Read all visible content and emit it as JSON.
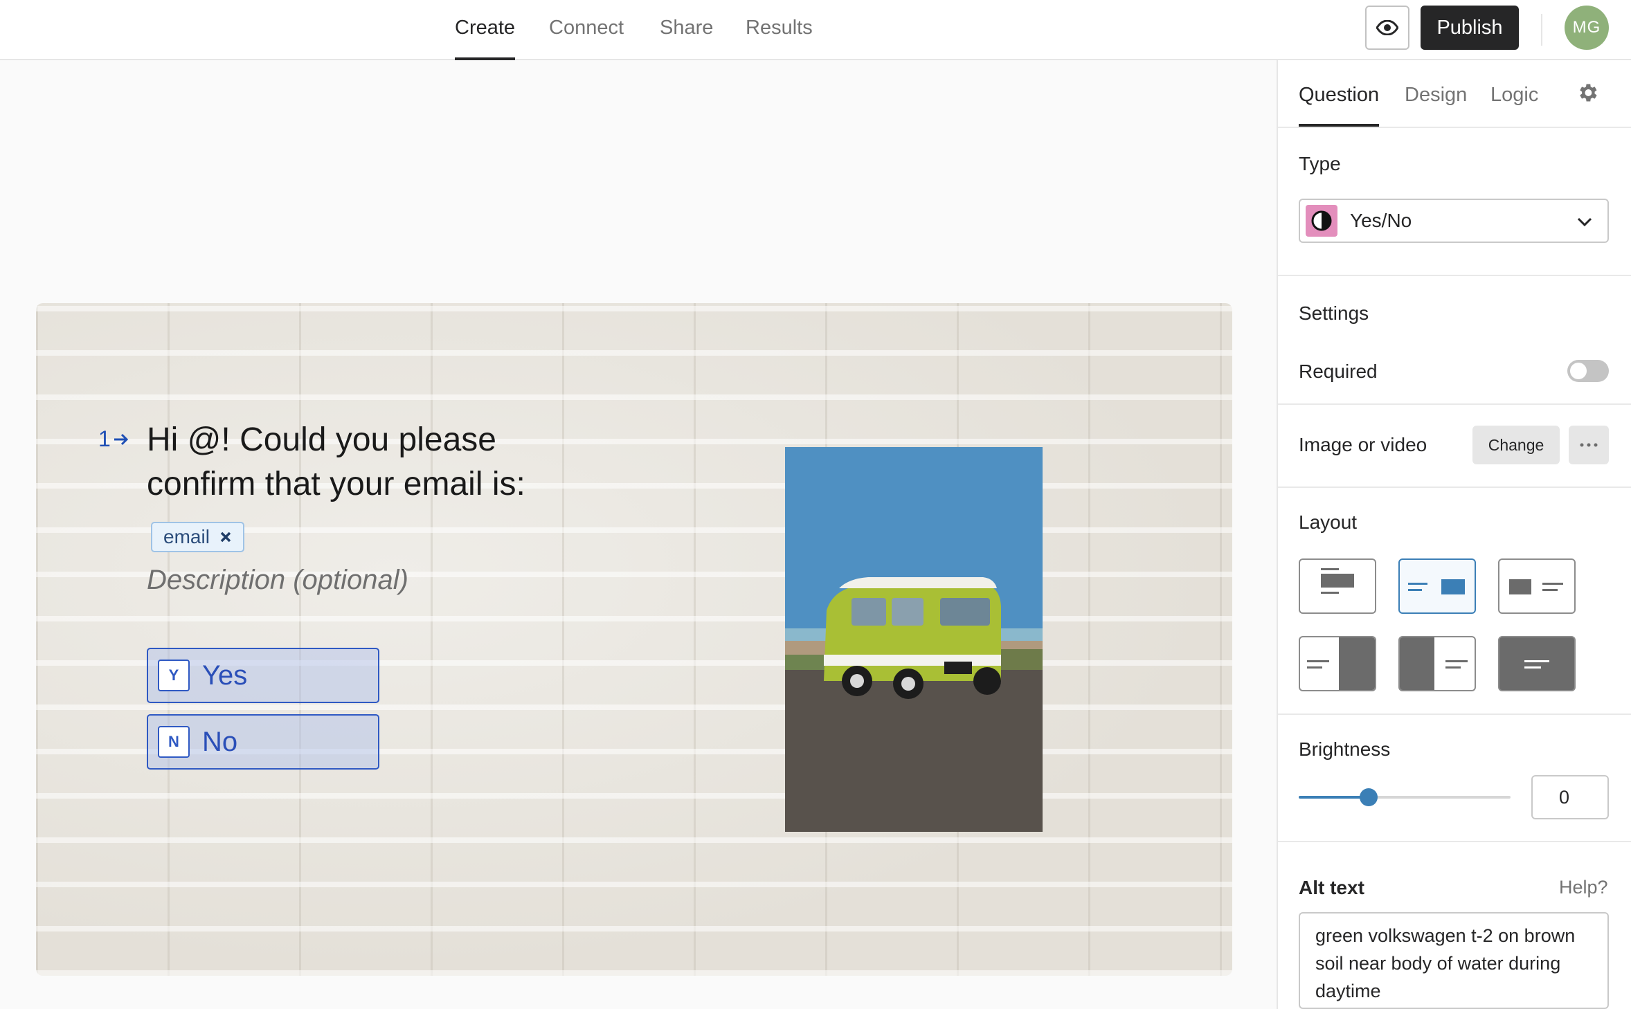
{
  "nav": {
    "tabs": [
      "Create",
      "Connect",
      "Share",
      "Results"
    ],
    "active_tab": "Create",
    "publish_label": "Publish",
    "avatar_initials": "MG"
  },
  "question": {
    "number": "1",
    "title": "Hi @! Could you please confirm that your email is:",
    "variable_chip": "email",
    "description_placeholder": "Description (optional)",
    "choices": [
      {
        "key": "Y",
        "label": "Yes"
      },
      {
        "key": "N",
        "label": "No"
      }
    ]
  },
  "panel": {
    "tabs": [
      "Question",
      "Design",
      "Logic"
    ],
    "active_tab": "Question",
    "type_heading": "Type",
    "type_value": "Yes/No",
    "settings_heading": "Settings",
    "required_label": "Required",
    "required_enabled": false,
    "media_label": "Image or video",
    "change_label": "Change",
    "layout_heading": "Layout",
    "layout_selected": 2,
    "brightness_heading": "Brightness",
    "brightness_value": "0",
    "brightness_level": 0.33,
    "alt_text_heading": "Alt text",
    "help_label": "Help?",
    "alt_text_value": "green volkswagen t-2 on brown soil near body of water during daytime"
  },
  "colors": {
    "accent_blue": "#3b7fb6",
    "answer_blue": "#2f59c3",
    "type_icon_pink": "#e38ebc",
    "dark": "#262627"
  },
  "icons": [
    "eye-icon",
    "gear-icon",
    "arrow-right-icon",
    "close-icon",
    "yes-no-icon",
    "chevron-down-icon",
    "more-dots-icon"
  ]
}
